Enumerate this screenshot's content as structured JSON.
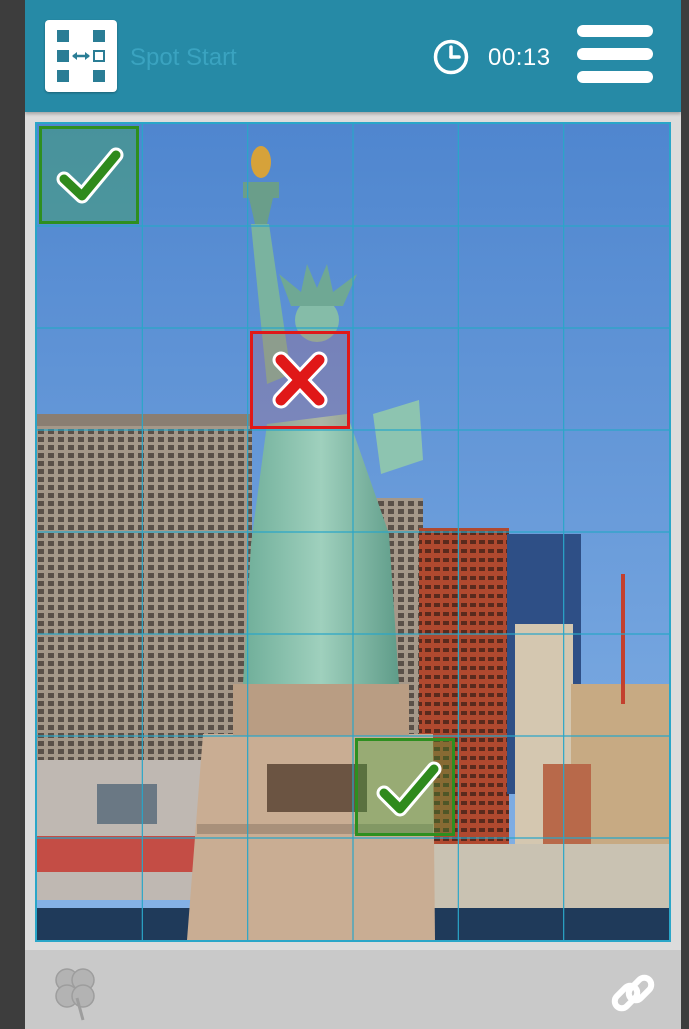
{
  "header": {
    "title": "Spot Start",
    "timer_value": "00:13",
    "logo_icon": "puzzle-swap-icon",
    "timer_icon": "clock-icon",
    "menu_icon": "hamburger-menu-icon"
  },
  "board": {
    "grid_columns": 6,
    "grid_rows": 8,
    "grid_color": "#2aa6c8",
    "marks": [
      {
        "type": "correct",
        "icon": "check-icon",
        "row": 1,
        "col": 1
      },
      {
        "type": "wrong",
        "icon": "cross-icon",
        "row": 3,
        "col": 3
      },
      {
        "type": "correct",
        "icon": "check-icon",
        "row": 7,
        "col": 4
      }
    ]
  },
  "footer": {
    "left_icon": "clover-icon",
    "right_icon": "link-icon"
  },
  "colors": {
    "header_bg": "#268aa6",
    "title_color": "#3aa3c0",
    "correct_color": "#2e8f1f",
    "wrong_color": "#e01818"
  }
}
